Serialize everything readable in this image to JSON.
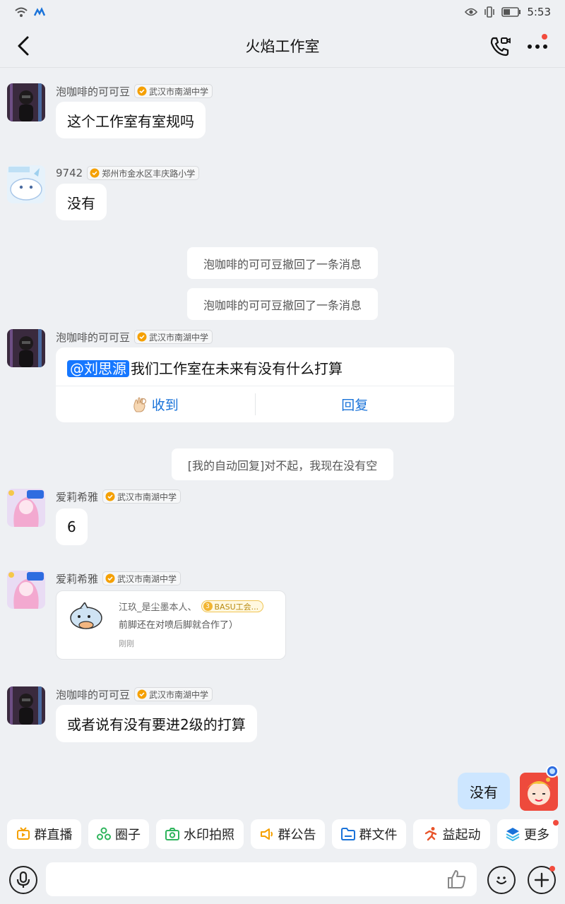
{
  "statusbar": {
    "time": "5:53"
  },
  "header": {
    "title": "火焰工作室"
  },
  "messages": [
    {
      "sender": "泡咖啡的可可豆",
      "badge": "武汉市南湖中学",
      "text": "这个工作室有室规吗"
    },
    {
      "sender": "9742",
      "badge": "郑州市金水区丰庆路小学",
      "text": "没有"
    },
    {
      "sender": "泡咖啡的可可豆",
      "badge": "武汉市南湖中学",
      "mention": "@刘思源",
      "text": "我们工作室在未来有没有什么打算",
      "action_ack": "收到",
      "action_reply": "回复"
    },
    {
      "sender": "爱莉希雅",
      "badge": "武汉市南湖中学",
      "text": "6"
    },
    {
      "sender": "爱莉希雅",
      "badge": "武汉市南湖中学",
      "share": {
        "name": "江玖_是尘墨本人、",
        "tag": "BASU工会...",
        "tag_level": "3",
        "text": "前脚还在对喷后脚就合作了）",
        "time": "刚刚"
      }
    },
    {
      "sender": "泡咖啡的可可豆",
      "badge": "武汉市南湖中学",
      "text": "或者说有没有要进2级的打算"
    }
  ],
  "system_tips": [
    "泡咖啡的可可豆撤回了一条消息",
    "泡咖啡的可可豆撤回了一条消息",
    "[我的自动回复]对不起，我现在没有空"
  ],
  "my_message": {
    "text": "没有"
  },
  "toolbar": {
    "items": [
      {
        "label": "群直播",
        "icon": "live-tv-icon",
        "color": "#f5a000"
      },
      {
        "label": "圈子",
        "icon": "circle-group-icon",
        "color": "#2fb55d"
      },
      {
        "label": "水印拍照",
        "icon": "camera-icon",
        "color": "#2fb55d"
      },
      {
        "label": "群公告",
        "icon": "megaphone-icon",
        "color": "#f5a000"
      },
      {
        "label": "群文件",
        "icon": "folder-icon",
        "color": "#1a73d9"
      },
      {
        "label": "益起动",
        "icon": "runner-icon",
        "color": "#e8542a"
      },
      {
        "label": "更多",
        "icon": "more-apps-icon",
        "color": "#1a73d9"
      }
    ]
  },
  "input": {
    "placeholder": ""
  }
}
